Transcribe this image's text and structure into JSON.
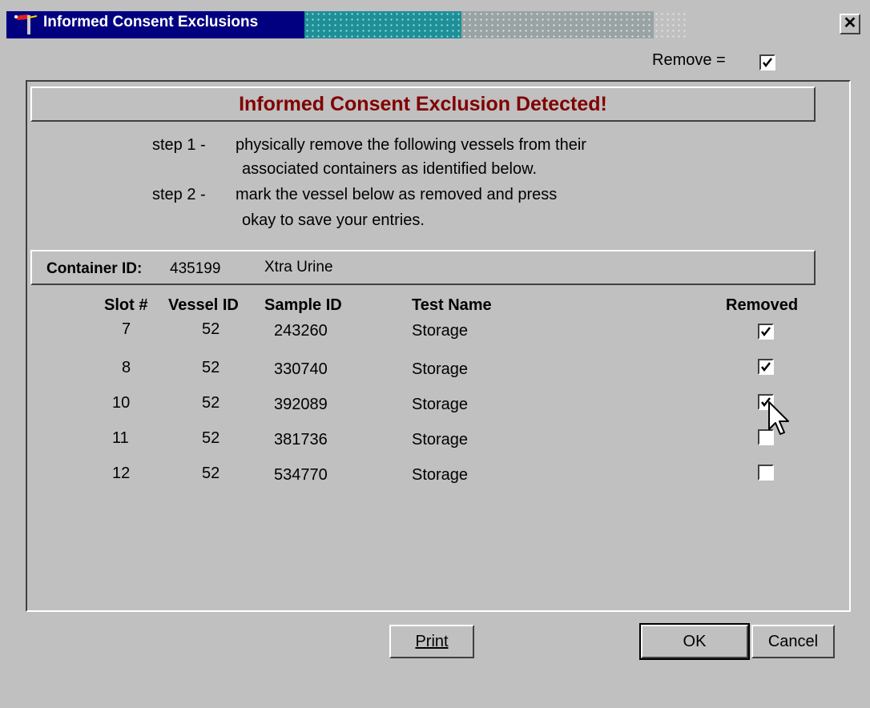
{
  "window": {
    "title": "Informed Consent Exclusions",
    "close_glyph": "✕"
  },
  "legend": {
    "label": "Remove =",
    "checked": true
  },
  "banner": {
    "text": "Informed Consent Exclusion Detected!"
  },
  "instructions": {
    "step1_prefix": "step 1 -",
    "step1_line1": "physically remove the following vessels from their",
    "step1_line2": "associated containers as identified below.",
    "step2_prefix": "step 2 -",
    "step2_line1": "mark the vessel below as removed and press",
    "step2_line2": "okay to save your entries."
  },
  "container": {
    "label": "Container ID:",
    "id": "435199",
    "type": "Xtra Urine"
  },
  "table": {
    "headers": {
      "slot": "Slot #",
      "vessel": "Vessel ID",
      "sample": "Sample ID",
      "test": "Test Name",
      "removed": "Removed"
    },
    "rows": [
      {
        "slot": "7",
        "vessel": "52",
        "sample": "243260",
        "test": "Storage",
        "removed": true
      },
      {
        "slot": "8",
        "vessel": "52",
        "sample": "330740",
        "test": "Storage",
        "removed": true
      },
      {
        "slot": "10",
        "vessel": "52",
        "sample": "392089",
        "test": "Storage",
        "removed": true
      },
      {
        "slot": "11",
        "vessel": "52",
        "sample": "381736",
        "test": "Storage",
        "removed": false
      },
      {
        "slot": "12",
        "vessel": "52",
        "sample": "534770",
        "test": "Storage",
        "removed": false
      }
    ]
  },
  "buttons": {
    "print": "Print",
    "ok": "OK",
    "cancel": "Cancel"
  },
  "colors": {
    "titlebar": "#000080",
    "banner_text": "#800000",
    "face": "#c0c0c0"
  }
}
